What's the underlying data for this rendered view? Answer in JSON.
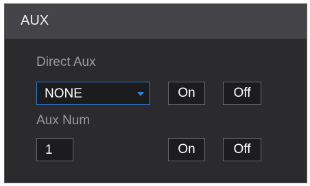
{
  "dialog": {
    "title": "AUX"
  },
  "direct_aux": {
    "label": "Direct Aux",
    "selected": "NONE",
    "on_label": "On",
    "off_label": "Off"
  },
  "aux_num": {
    "label": "Aux Num",
    "value": "1",
    "on_label": "On",
    "off_label": "Off"
  },
  "colors": {
    "background": "#2b2b2d",
    "titlebar": "#444448",
    "accent": "#2a7bd8"
  }
}
